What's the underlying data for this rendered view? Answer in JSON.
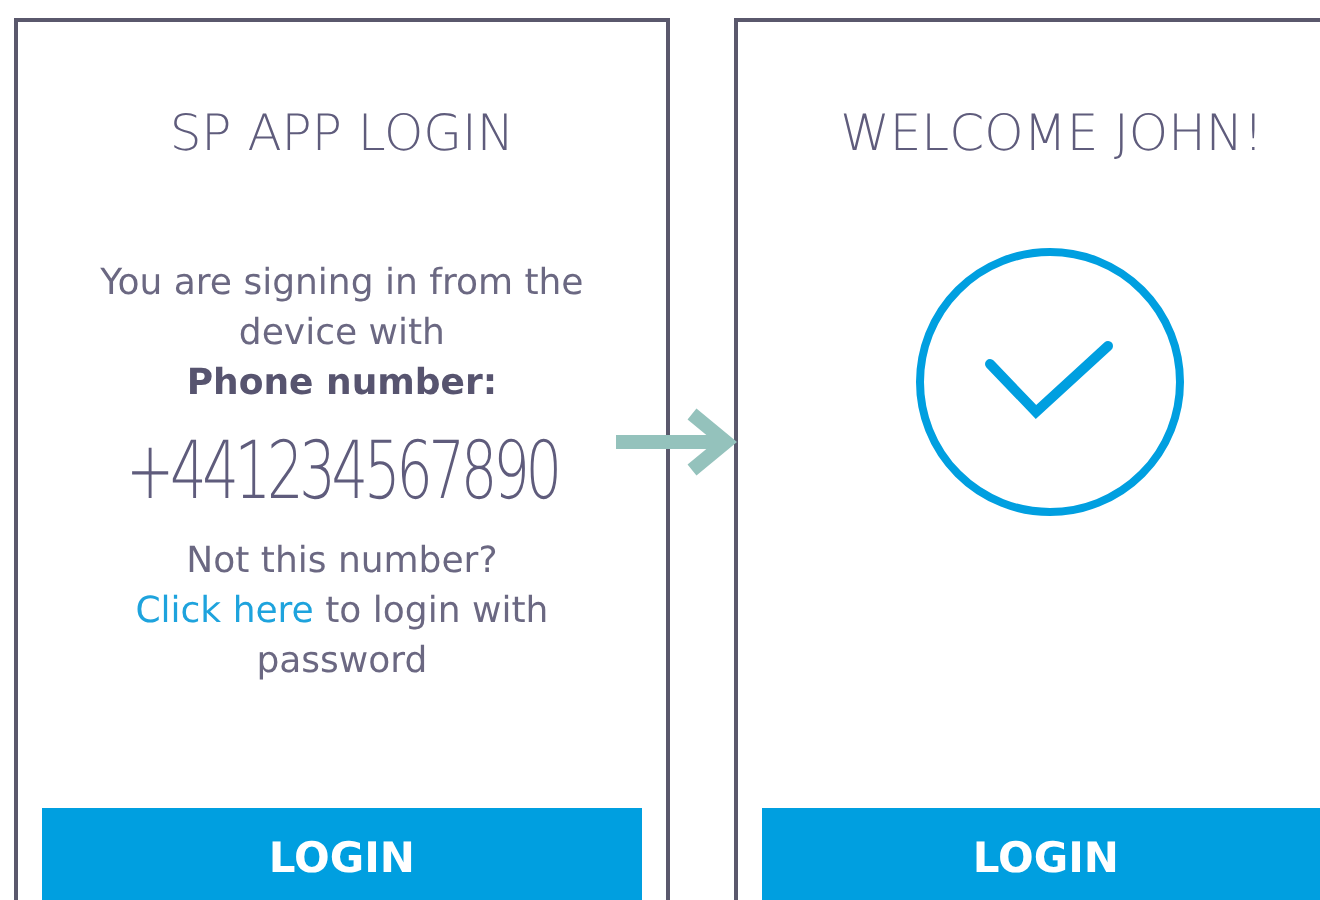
{
  "screens": [
    {
      "kind": "login",
      "title": "SP APP LOGIN",
      "message": "You are signing in from the device with",
      "label": "Phone number:",
      "phone": "+441234567890",
      "question": "Not this number?",
      "link": "Click here",
      "link_rest": "to login with password",
      "button": "LOGIN"
    },
    {
      "kind": "welcome",
      "title": "WELCOME JOHN!",
      "button": "LOGIN"
    }
  ]
}
